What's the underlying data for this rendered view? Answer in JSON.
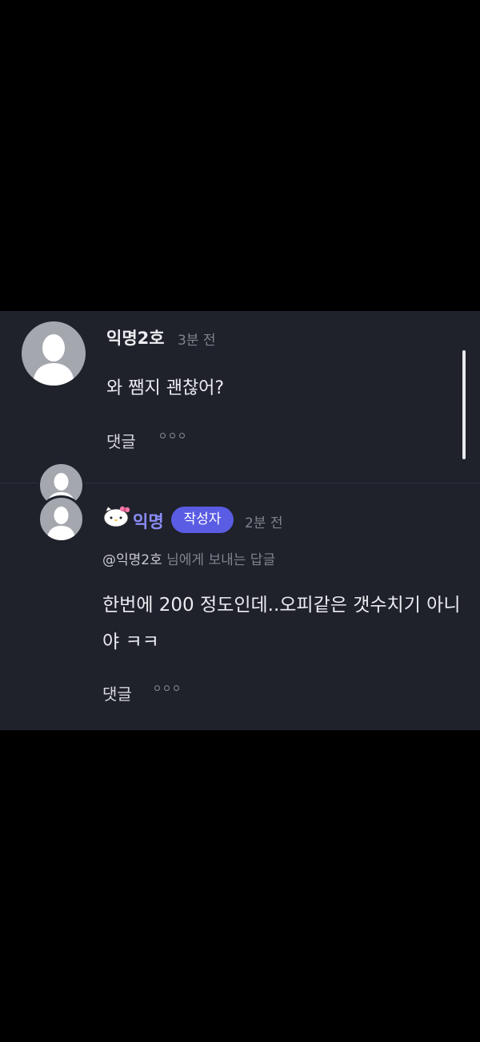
{
  "comments": [
    {
      "author": "익명2호",
      "time": "3분 전",
      "body": "와 쨈지 괜찮어?",
      "reply_label": "댓글",
      "more_icon": "more-dots-icon"
    },
    {
      "author": "익명",
      "author_badge": "작성자",
      "time": "2분 전",
      "mention": "@익명2호",
      "mention_suffix": " 님에게 보내는 답글",
      "body": "한번에 200 정도인데..오피같은 갯수치기 아니야 ㅋㅋ",
      "reply_label": "댓글",
      "more_icon": "more-dots-icon",
      "avatar_badge_icon": "hello-kitty-icon"
    }
  ],
  "colors": {
    "background": "#000000",
    "panel": "#1f212b",
    "accent": "#5a5ce3",
    "author_accent": "#8b8df7"
  }
}
